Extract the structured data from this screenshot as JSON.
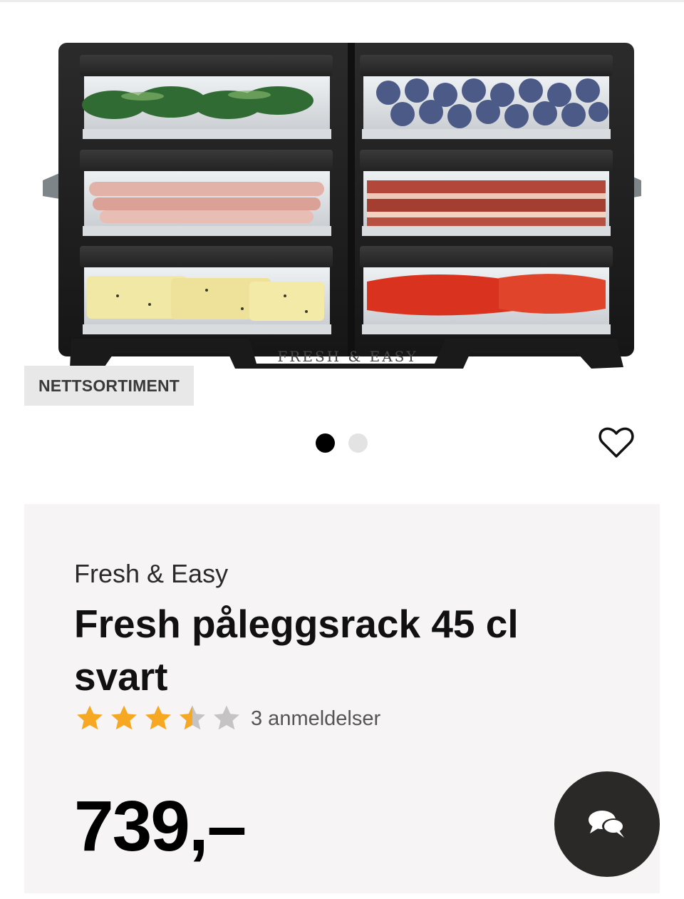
{
  "badge": {
    "label": "NETTSORTIMENT"
  },
  "carousel": {
    "count": 2,
    "active_index": 0
  },
  "product": {
    "brand": "Fresh & Easy",
    "title": "Fresh påleggsrack 45 cl svart",
    "rating": 3.5,
    "rating_max": 5,
    "review_count_label": "3 anmeldelser",
    "price": "739,–",
    "image_logo_text": "FRESH & EASY"
  },
  "colors": {
    "star_filled": "#f7a823",
    "star_empty": "#c4c4c4",
    "card_background": "#f6f4f4",
    "badge_background": "#e8e8e8",
    "chat_button": "#2b2828"
  },
  "icons": {
    "favorite": "heart-outline-icon",
    "chat": "chat-bubbles-icon",
    "rating": "star-icon"
  }
}
